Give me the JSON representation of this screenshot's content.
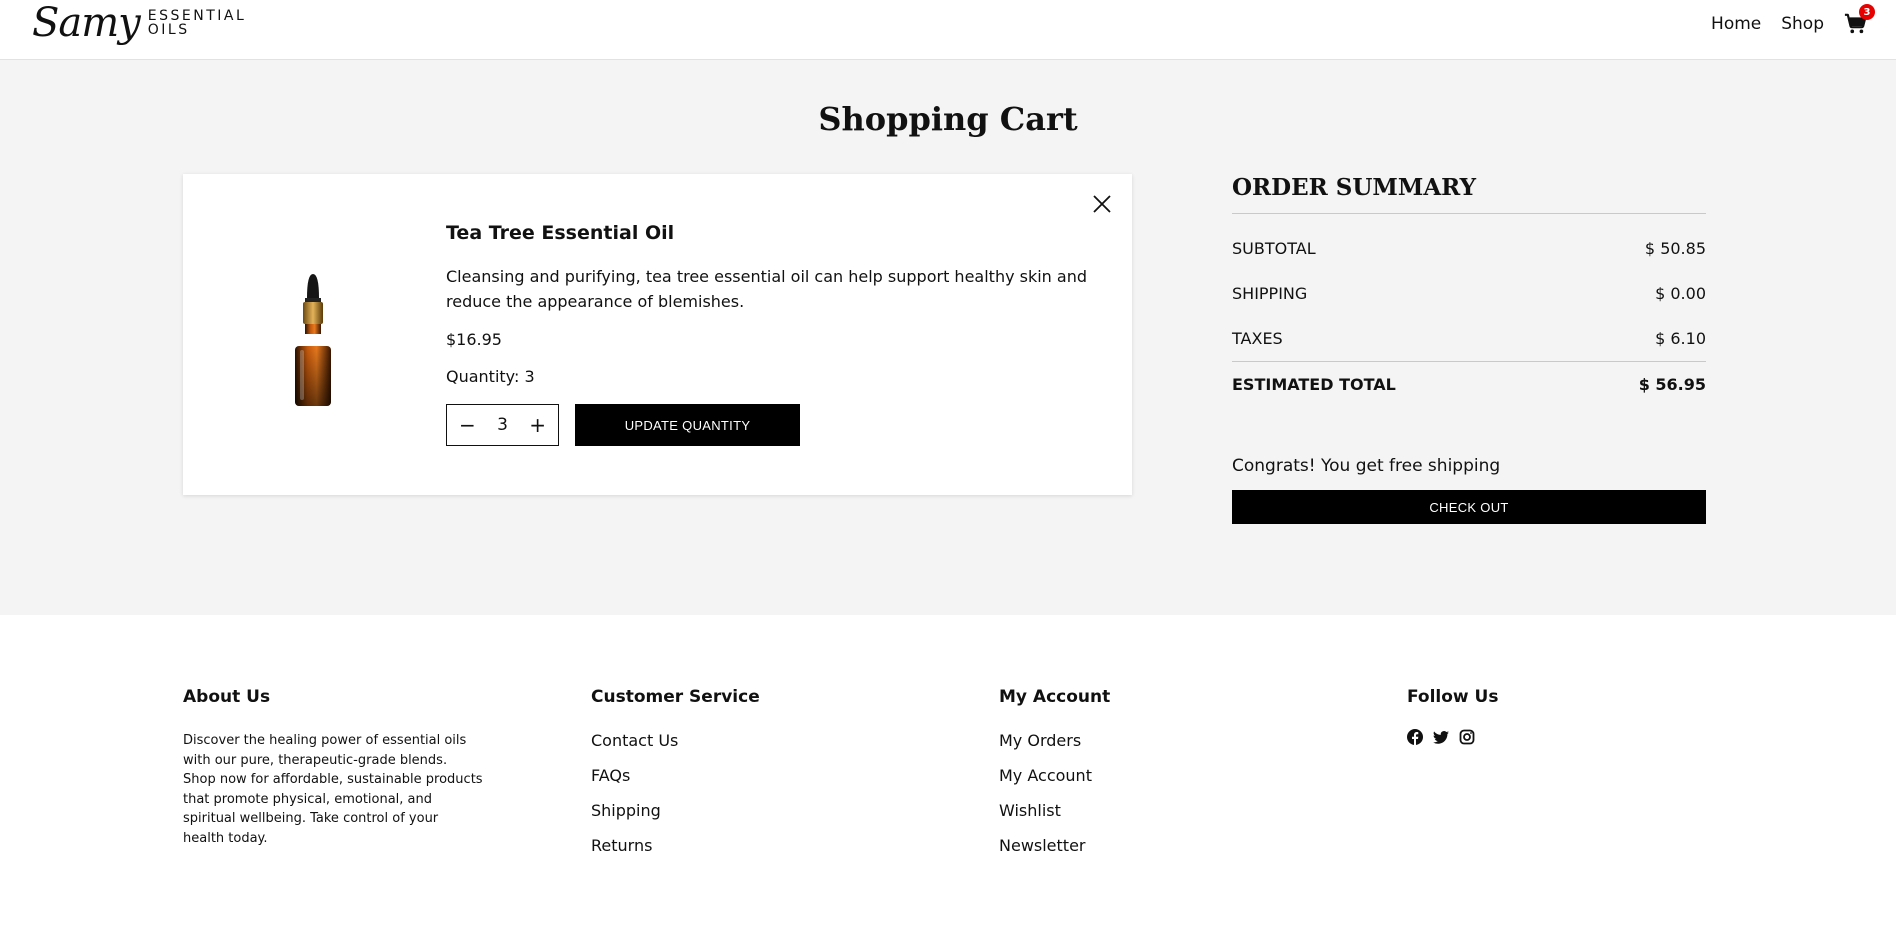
{
  "header": {
    "logo_script": "Samy",
    "logo_line1": "ESSENTIAL",
    "logo_line2": "OILS",
    "nav": [
      {
        "label": "Home"
      },
      {
        "label": "Shop"
      }
    ],
    "cart_count": "3"
  },
  "page": {
    "title": "Shopping Cart"
  },
  "cart": {
    "items": [
      {
        "name": "Tea Tree Essential Oil",
        "description": "Cleansing and purifying, tea tree essential oil can help support healthy skin and reduce the appearance of blemishes.",
        "price": "$16.95",
        "quantity_text": "Quantity: 3",
        "quantity_value": "3",
        "decrement": "−",
        "increment": "+",
        "update_label": "UPDATE QUANTITY"
      }
    ]
  },
  "summary": {
    "title": "ORDER SUMMARY",
    "subtotal_label": "SUBTOTAL",
    "subtotal_value": "$ 50.85",
    "shipping_label": "SHIPPING",
    "shipping_value": "$ 0.00",
    "taxes_label": "TAXES",
    "taxes_value": "$ 6.10",
    "total_label": "ESTIMATED TOTAL",
    "total_value": "$ 56.95",
    "free_shipping_text": "Congrats! You get free shipping",
    "checkout_label": "CHECK OUT"
  },
  "footer": {
    "about": {
      "title": "About Us",
      "text": "Discover the healing power of essential oils with our pure, therapeutic-grade blends. Shop now for affordable, sustainable products that promote physical, emotional, and spiritual wellbeing. Take control of your health today."
    },
    "customer_service": {
      "title": "Customer Service",
      "links": [
        "Contact Us",
        "FAQs",
        "Shipping",
        "Returns"
      ]
    },
    "my_account": {
      "title": "My Account",
      "links": [
        "My Orders",
        "My Account",
        "Wishlist",
        "Newsletter"
      ]
    },
    "follow": {
      "title": "Follow Us",
      "icons": [
        "facebook-icon",
        "twitter-icon",
        "instagram-icon"
      ]
    }
  }
}
